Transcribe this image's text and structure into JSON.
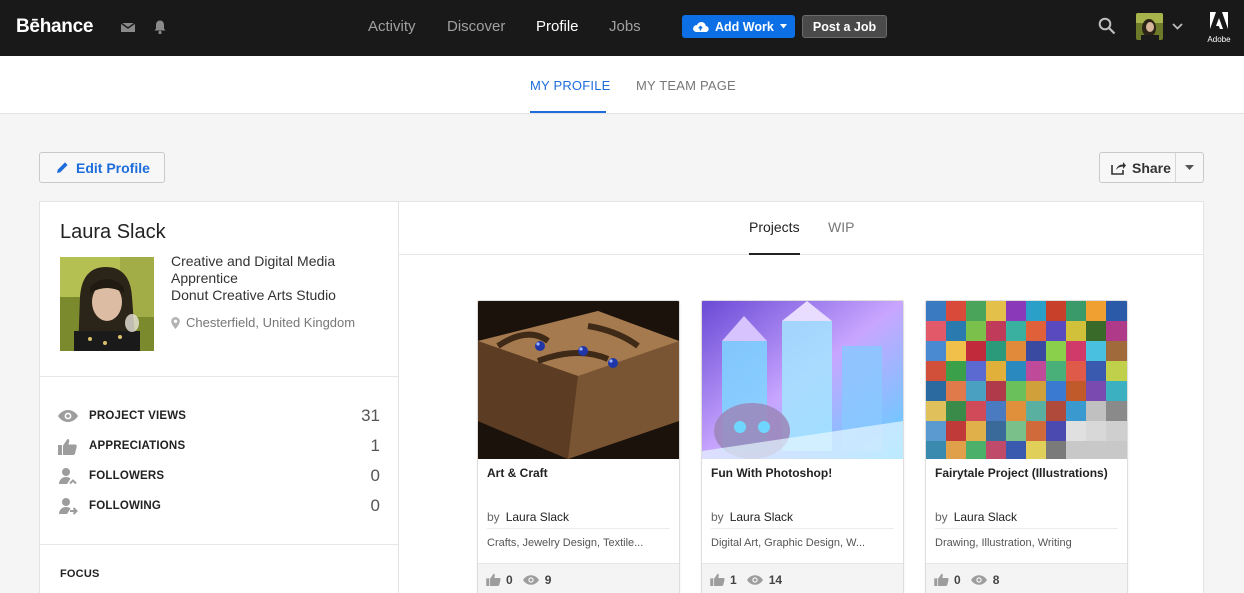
{
  "topbar": {
    "logo": "Bēhance",
    "nav": [
      "Activity",
      "Discover",
      "Profile",
      "Jobs"
    ],
    "active_nav": "Profile",
    "add_work_label": "Add Work",
    "post_job_label": "Post a Job",
    "adobe_label": "Adobe",
    "icons": [
      "mail-icon",
      "bell-icon",
      "search-icon",
      "chevron-down-icon",
      "adobe-logo"
    ]
  },
  "subnav": {
    "tabs": [
      "MY PROFILE",
      "MY TEAM PAGE"
    ],
    "active": "MY PROFILE",
    "accent": "#1e6ddb"
  },
  "actions": {
    "edit_profile": "Edit Profile",
    "share": "Share"
  },
  "profile": {
    "name": "Laura Slack",
    "occupation": "Creative and Digital Media Apprentice",
    "company": "Donut Creative Arts Studio",
    "location": "Chesterfield, United Kingdom",
    "stats": [
      {
        "label": "PROJECT VIEWS",
        "value": "31",
        "icon": "eye-icon"
      },
      {
        "label": "APPRECIATIONS",
        "value": "1",
        "icon": "thumbs-up-icon"
      },
      {
        "label": "FOLLOWERS",
        "value": "0",
        "icon": "follower-icon"
      },
      {
        "label": "FOLLOWING",
        "value": "0",
        "icon": "following-icon"
      }
    ],
    "focus_label": "FOCUS"
  },
  "content": {
    "tabs": [
      "Projects",
      "WIP"
    ],
    "active": "Projects",
    "by_label": "by",
    "projects": [
      {
        "title": "Art & Craft",
        "author": "Laura Slack",
        "fields": "Crafts, Jewelry Design, Textile...",
        "appreciations": "0",
        "views": "9"
      },
      {
        "title": "Fun With Photoshop!",
        "author": "Laura Slack",
        "fields": "Digital Art, Graphic Design, W...",
        "appreciations": "1",
        "views": "14"
      },
      {
        "title": "Fairytale Project (Illustrations)",
        "author": "Laura Slack",
        "fields": "Drawing, Illustration, Writing",
        "appreciations": "0",
        "views": "8"
      }
    ]
  }
}
